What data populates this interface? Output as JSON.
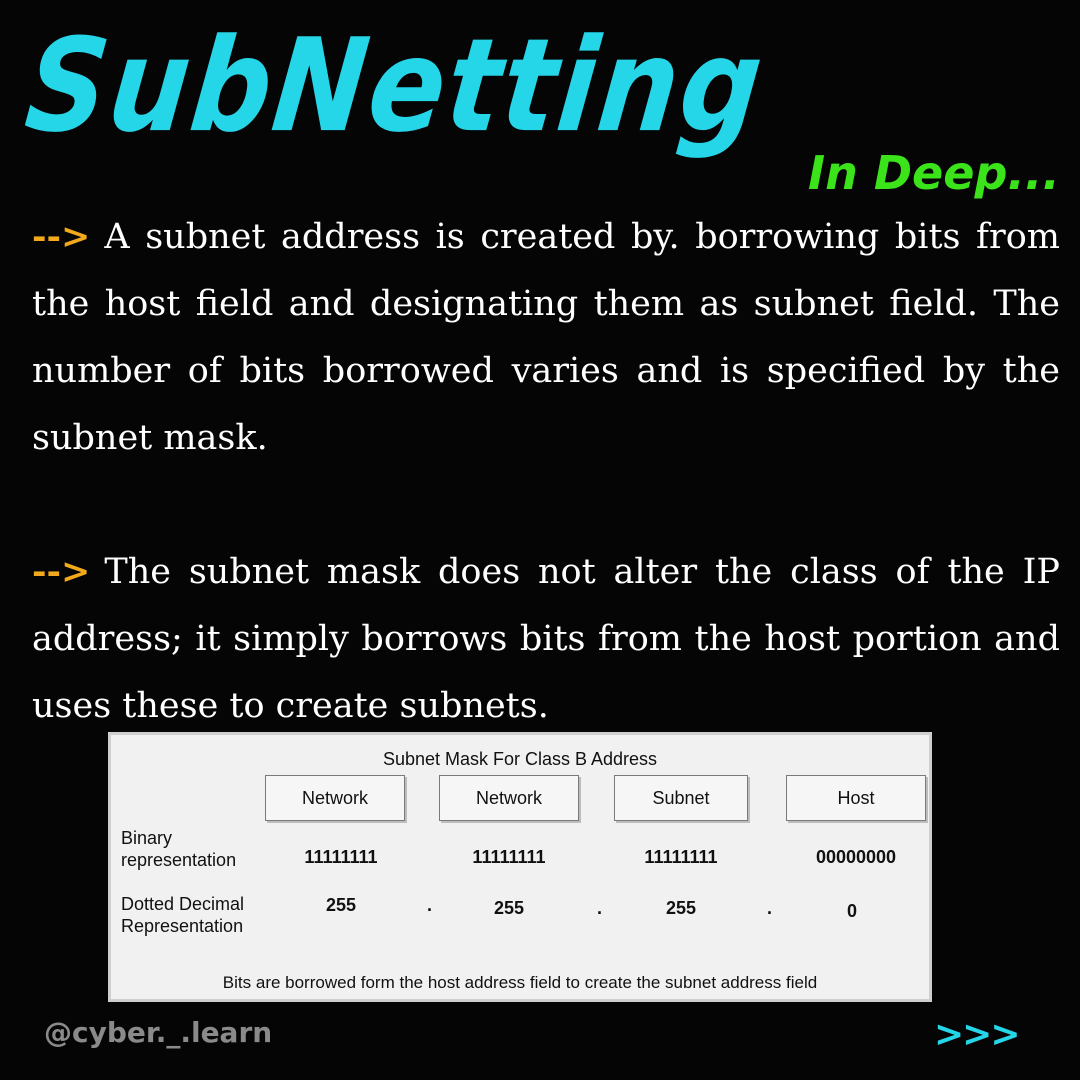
{
  "title": "SubNetting",
  "subtitle": "In Deep...",
  "bullet_marker": "-->",
  "paragraphs": [
    "A subnet address is created by. borrowing bits from the host field and designating them as subnet field. The number of bits borrowed varies and is specified by the subnet mask.",
    "The subnet mask does not alter the class of the IP address; it simply borrows bits from the host portion and uses these to create subnets."
  ],
  "figure": {
    "title": "Subnet Mask For Class B Address",
    "columns": [
      "Network",
      "Network",
      "Subnet",
      "Host"
    ],
    "rows": [
      {
        "label_line1": "Binary",
        "label_line2": "representation",
        "values": [
          "11111111",
          "11111111",
          "11111111",
          "00000000"
        ]
      },
      {
        "label_line1": "Dotted Decimal",
        "label_line2": "Representation",
        "values": [
          "255",
          "255",
          "255",
          "0"
        ]
      }
    ],
    "separator": ".",
    "caption": "Bits are borrowed form the host address field to create the subnet address field"
  },
  "footer": {
    "handle": "@cyber._.learn",
    "next_label": ">>>"
  },
  "colors": {
    "background": "#050506",
    "title": "#25d6e8",
    "subtitle": "#3be41a",
    "arrow": "#f3a91c",
    "body_text": "#ffffff",
    "handle": "#8a8a8a"
  }
}
